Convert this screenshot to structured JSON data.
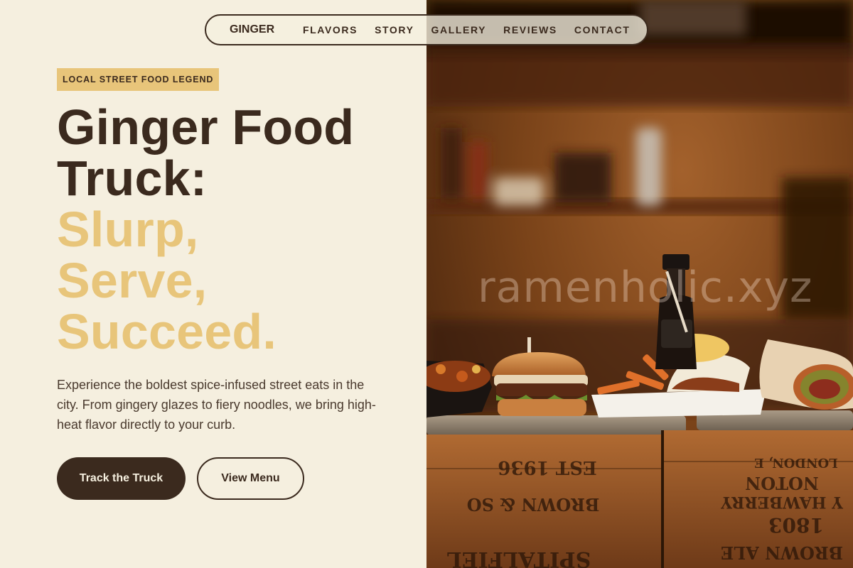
{
  "nav": {
    "brand": "GINGER",
    "links": [
      "FLAVORS",
      "STORY",
      "GALLERY",
      "REVIEWS",
      "CONTACT"
    ]
  },
  "hero": {
    "badge": "LOCAL STREET FOOD LEGEND",
    "headline_lines": [
      "Ginger Food",
      "Truck:"
    ],
    "accent_lines": [
      "Slurp,",
      "Serve,",
      "Succeed."
    ],
    "description": "Experience the boldest spice-infused street eats in the city. From gingery glazes to fiery noodles, we bring high-heat flavor directly to your curb.",
    "primary_cta": "Track the Truck",
    "secondary_cta": "View Menu"
  },
  "image": {
    "watermark": "ramenholic.xyz",
    "crate_text_left": [
      "EST 1936",
      "BROWN & SO",
      "SPITALFIEL"
    ],
    "crate_text_right": [
      "LONDON, E",
      "NOTON",
      "Y HAWBERRY",
      "1803",
      "BROWN ALE"
    ]
  },
  "colors": {
    "background": "#f5efdf",
    "dark": "#3b2a1e",
    "accent": "#e8c57a"
  }
}
